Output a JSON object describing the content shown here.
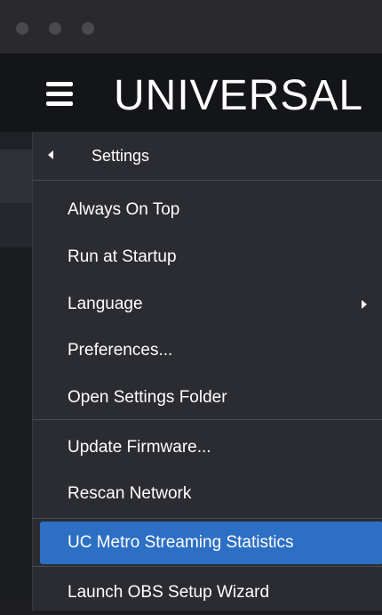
{
  "window": {
    "traffic_lights": [
      "close",
      "minimize",
      "zoom"
    ]
  },
  "header": {
    "menu_icon": "hamburger-icon",
    "title": "UNIVERSAL"
  },
  "menu": {
    "back_icon": "chevron-left-icon",
    "header_label": "Settings",
    "items": [
      {
        "label": "Always On Top"
      },
      {
        "label": "Run at Startup"
      },
      {
        "label": "Language",
        "submenu": true
      },
      {
        "label": "Preferences..."
      },
      {
        "label": "Open Settings Folder"
      },
      {
        "label": "Update Firmware..."
      },
      {
        "label": "Rescan Network"
      },
      {
        "label": "UC Metro Streaming Statistics",
        "highlighted": true
      },
      {
        "label": "Launch OBS Setup Wizard"
      }
    ],
    "highlight_color": "#2d6fc4"
  }
}
